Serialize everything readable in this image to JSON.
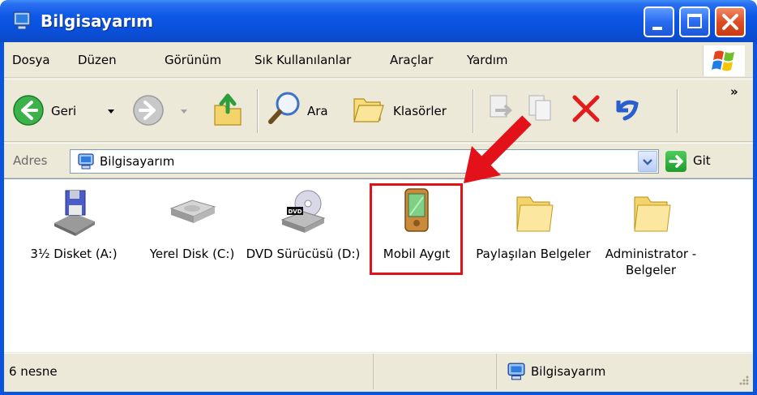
{
  "window": {
    "title": "Bilgisayarım",
    "minimize_icon": "minimize-icon",
    "maximize_icon": "maximize-icon",
    "close_icon": "close-icon"
  },
  "menu": {
    "items": [
      "Dosya",
      "Düzen",
      "Görünüm",
      "Sık Kullanılanlar",
      "Araçlar",
      "Yardım"
    ]
  },
  "toolbar": {
    "back_label": "Geri",
    "search_label": "Ara",
    "folders_label": "Klasörler",
    "overflow": "»"
  },
  "address": {
    "label": "Adres",
    "value": "Bilgisayarım",
    "go_label": "Git"
  },
  "items": [
    {
      "label": "3½ Disket (A:)",
      "icon": "floppy-drive-icon"
    },
    {
      "label": "Yerel Disk (C:)",
      "icon": "hard-disk-icon"
    },
    {
      "label": "DVD Sürücüsü (D:)",
      "icon": "dvd-drive-icon"
    },
    {
      "label": "Mobil Aygıt",
      "icon": "mobile-device-icon"
    },
    {
      "label": "Paylaşılan Belgeler",
      "icon": "folder-icon"
    },
    {
      "label": "Administrator - Belgeler",
      "icon": "folder-icon"
    }
  ],
  "status": {
    "count": "6 nesne",
    "location": "Bilgisayarım"
  },
  "colors": {
    "titlebar": "#0a54e0",
    "highlight": "#e3121a",
    "window_bg": "#ece9d8"
  }
}
